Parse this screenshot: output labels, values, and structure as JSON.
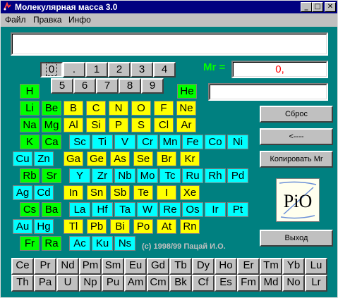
{
  "window": {
    "title": "Молекулярная масса 3.0",
    "controls": {
      "minimize": "_",
      "maximize": "□",
      "close": "✕"
    }
  },
  "menu": {
    "file": "Файл",
    "edit": "Правка",
    "info": "Инфо"
  },
  "formula_input": {
    "value": ""
  },
  "keypad": {
    "row1": [
      "0",
      ".",
      "1",
      "2",
      "3",
      "4"
    ],
    "row2": [
      "5",
      "6",
      "7",
      "8",
      "9"
    ],
    "selected": "0"
  },
  "mr": {
    "label": "Mr =",
    "value": "0,"
  },
  "result2": {
    "value": ""
  },
  "buttons": {
    "reset": "Сброс",
    "backspace": "<----",
    "copy": "Копировать Mr",
    "exit": "Выход"
  },
  "logo": {
    "text": "PiO"
  },
  "copyright": "(c) 1998/99 Пацай И.О.",
  "elements": [
    [
      "H",
      "He"
    ],
    [
      "Li",
      "Be",
      "B",
      "C",
      "N",
      "O",
      "F",
      "Ne"
    ],
    [
      "Na",
      "Mg",
      "Al",
      "Si",
      "P",
      "S",
      "Cl",
      "Ar"
    ],
    [
      "K",
      "Ca",
      "Sc",
      "Ti",
      "V",
      "Cr",
      "Mn",
      "Fe",
      "Co",
      "Ni"
    ],
    [
      "Cu",
      "Zn",
      "Ga",
      "Ge",
      "As",
      "Se",
      "Br",
      "Kr"
    ],
    [
      "Rb",
      "Sr",
      "Y",
      "Zr",
      "Nb",
      "Mo",
      "Tc",
      "Ru",
      "Rh",
      "Pd"
    ],
    [
      "Ag",
      "Cd",
      "In",
      "Sn",
      "Sb",
      "Te",
      "I",
      "Xe"
    ],
    [
      "Cs",
      "Ba",
      "La",
      "Hf",
      "Ta",
      "W",
      "Re",
      "Os",
      "Ir",
      "Pt"
    ],
    [
      "Au",
      "Hg",
      "Tl",
      "Pb",
      "Bi",
      "Po",
      "At",
      "Rn"
    ],
    [
      "Fr",
      "Ra",
      "Ac",
      "Ku",
      "Ns"
    ]
  ],
  "lanthanides": [
    "Ce",
    "Pr",
    "Nd",
    "Pm",
    "Sm",
    "Eu",
    "Gd",
    "Tb",
    "Dy",
    "Ho",
    "Er",
    "Tm",
    "Yb",
    "Lu"
  ],
  "actinides": [
    "Th",
    "Pa",
    "U",
    "Np",
    "Pu",
    "Am",
    "Cm",
    "Bk",
    "Cf",
    "Es",
    "Fm",
    "Md",
    "No",
    "Lr"
  ],
  "colors": {
    "s_block": "#00ff00",
    "p_block": "#ffff00",
    "d_block": "#00ffff",
    "f_block": "#c0c0c0",
    "background": "#008080"
  }
}
